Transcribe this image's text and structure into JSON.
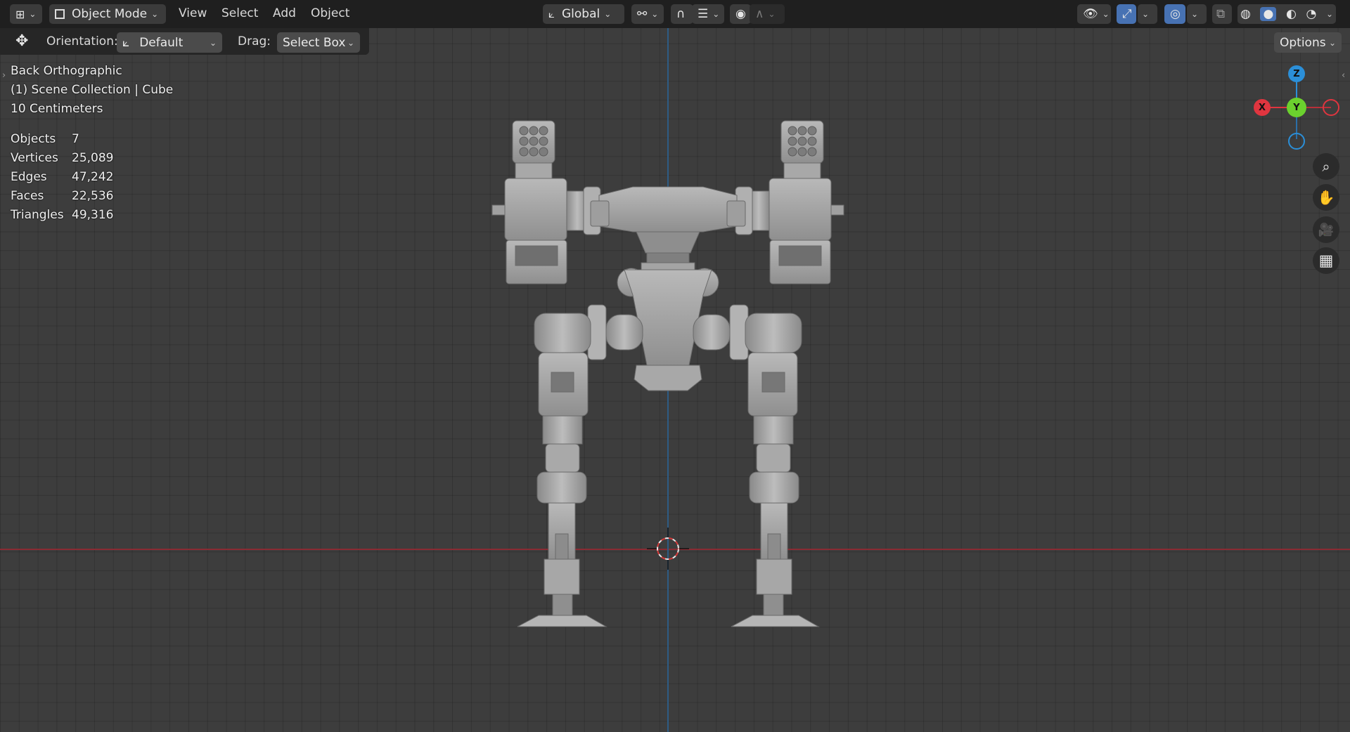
{
  "header": {
    "editor_type_icon": "grid-editor-icon",
    "mode": {
      "label": "Object Mode",
      "icon": "object-mode-icon"
    },
    "menus": [
      "View",
      "Select",
      "Add",
      "Object"
    ],
    "transform_orientation": {
      "label": "Global",
      "icon": "axes-icon"
    },
    "pivot_icon": "link-icon",
    "snap_icon": "magnet-icon",
    "snap_target_icon": "snap-increment-icon",
    "proportional_icon": "proportional-edit-icon",
    "falloff_icon": "falloff-curve-icon",
    "right": {
      "visibility_icon": "eye-icon",
      "gizmo_icon": "gizmo-icon",
      "overlay_icon": "overlay-icon",
      "xray_icon": "xray-icon",
      "shading_wireframe_icon": "wireframe-shading-icon",
      "shading_solid_icon": "solid-shading-icon",
      "shading_material_icon": "material-shading-icon",
      "shading_rendered_icon": "rendered-shading-icon"
    }
  },
  "toolbar": {
    "tool_icon": "move-tool-icon",
    "orientation_label": "Orientation:",
    "orientation_value": "Default",
    "drag_label": "Drag:",
    "drag_value": "Select Box",
    "options_label": "Options"
  },
  "overlay": {
    "view_name": "Back Orthographic",
    "collection": "(1) Scene Collection | Cube",
    "scale": "10 Centimeters",
    "stats": [
      {
        "label": "Objects",
        "value": "7"
      },
      {
        "label": "Vertices",
        "value": "25,089"
      },
      {
        "label": "Edges",
        "value": "47,242"
      },
      {
        "label": "Faces",
        "value": "22,536"
      },
      {
        "label": "Triangles",
        "value": "49,316"
      }
    ]
  },
  "gizmo": {
    "z": "Z",
    "x": "X",
    "y": "Y",
    "colors": {
      "x": "#e0353f",
      "y": "#6bd12e",
      "z": "#2b8fd8"
    }
  },
  "nav_buttons": [
    "zoom-icon",
    "pan-hand-icon",
    "camera-icon",
    "ortho-grid-icon"
  ],
  "colors": {
    "header": "#1f1f1f",
    "viewport": "#3d3d3d",
    "accent": "#4772b3"
  }
}
